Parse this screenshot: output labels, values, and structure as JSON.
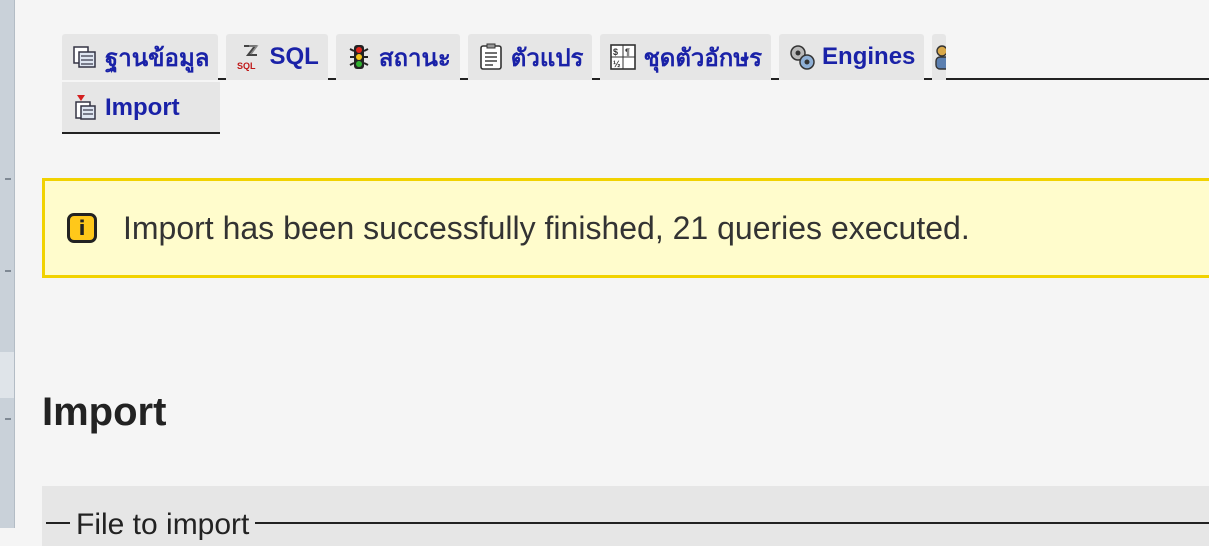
{
  "tabs": {
    "items": [
      {
        "label": "ฐานข้อมูล",
        "icon": "database-icon"
      },
      {
        "label": "SQL",
        "icon": "sql-icon"
      },
      {
        "label": "สถานะ",
        "icon": "status-icon"
      },
      {
        "label": "ตัวแปร",
        "icon": "variables-icon"
      },
      {
        "label": "ชุดตัวอักษร",
        "icon": "charset-icon"
      },
      {
        "label": "Engines",
        "icon": "engines-icon"
      }
    ],
    "active": {
      "label": "Import",
      "icon": "import-icon"
    }
  },
  "notice": {
    "text": "Import has been successfully finished, 21 queries executed.",
    "icon": "info-icon",
    "icon_glyph": "i",
    "bg_color": "#fffccc",
    "border_color": "#f1d200"
  },
  "page_title": "Import",
  "fieldset": {
    "legend": "File to import"
  },
  "colors": {
    "tab_text": "#1a22a8",
    "tab_bg": "#e6e6e6"
  }
}
